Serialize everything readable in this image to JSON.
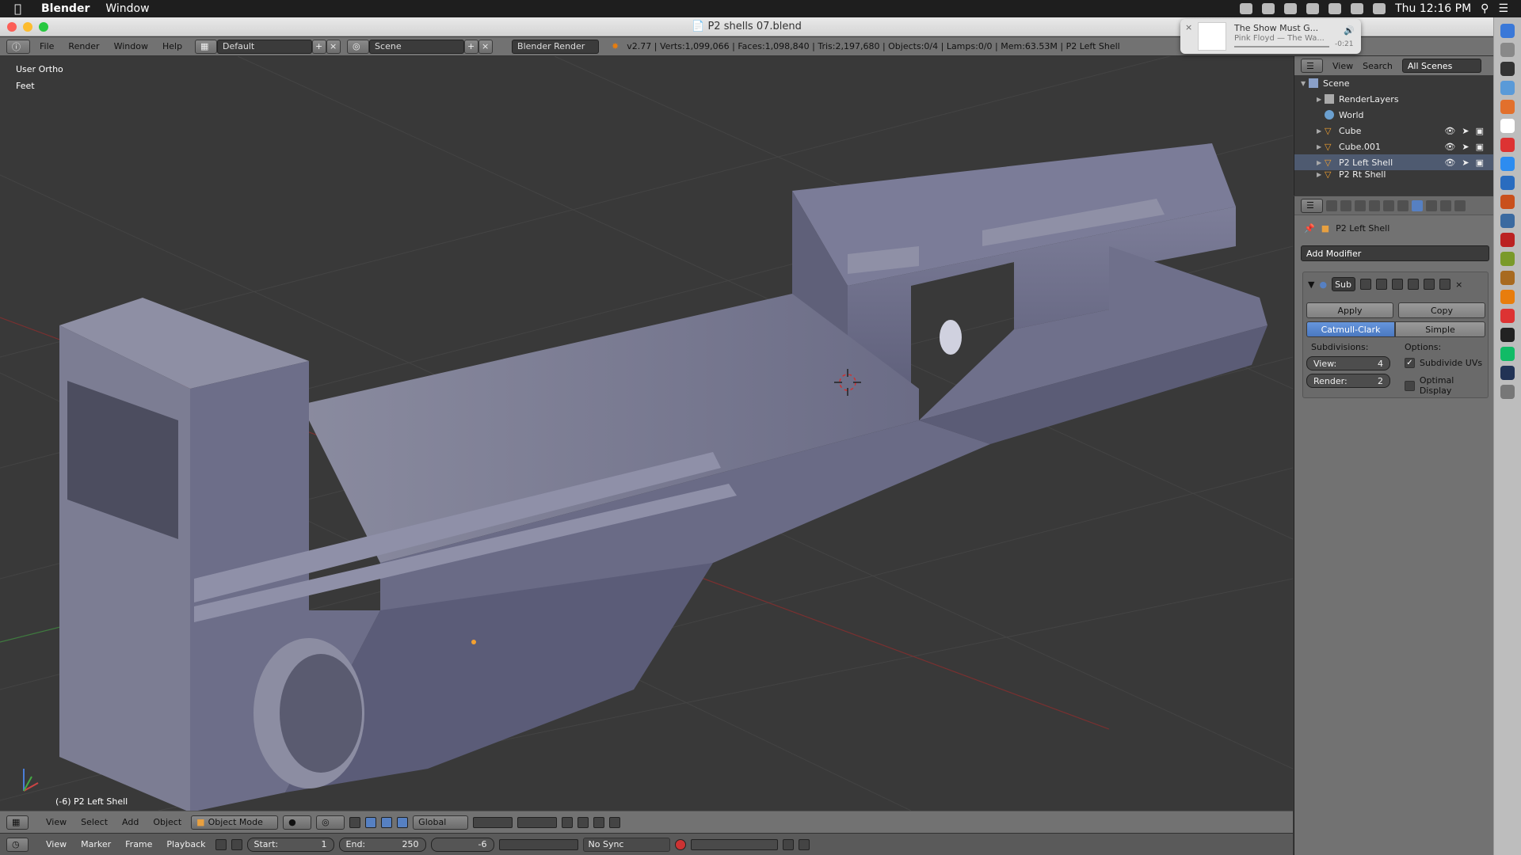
{
  "menubar": {
    "app": "Blender",
    "items": [
      "Window"
    ],
    "clock": "Thu 12:16 PM"
  },
  "window": {
    "title": "P2 shells 07.blend"
  },
  "info": {
    "menus": [
      "File",
      "Render",
      "Window",
      "Help"
    ],
    "layout": "Default",
    "scene": "Scene",
    "engine": "Blender Render",
    "stats": "v2.77 | Verts:1,099,066 | Faces:1,098,840 | Tris:2,197,680 | Objects:0/4 | Lamps:0/0 | Mem:63.53M | P2 Left Shell"
  },
  "viewport": {
    "view_name": "User Ortho",
    "units": "Feet",
    "object_label": "(-6) P2 Left Shell"
  },
  "vp_header": {
    "menus": [
      "View",
      "Select",
      "Add",
      "Object"
    ],
    "mode": "Object Mode",
    "orientation": "Global"
  },
  "timeline": {
    "menus": [
      "View",
      "Marker",
      "Frame",
      "Playback"
    ],
    "start": "Start:",
    "start_val": "1",
    "end": "End:",
    "end_val": "250",
    "current": "-6",
    "sync": "No Sync"
  },
  "outliner": {
    "menus": [
      "View",
      "Search"
    ],
    "filter": "All Scenes",
    "items": [
      {
        "label": "Scene"
      },
      {
        "label": "RenderLayers"
      },
      {
        "label": "World"
      },
      {
        "label": "Cube"
      },
      {
        "label": "Cube.001"
      },
      {
        "label": "P2 Left Shell"
      },
      {
        "label": "P2 Rt Shell"
      }
    ]
  },
  "props": {
    "object": "P2 Left Shell",
    "add_modifier": "Add Modifier",
    "mod_name": "Sub",
    "apply": "Apply",
    "copy": "Copy",
    "mode_a": "Catmull-Clark",
    "mode_b": "Simple",
    "subdivisions": "Subdivisions:",
    "options": "Options:",
    "view_label": "View:",
    "view_val": "4",
    "render_label": "Render:",
    "render_val": "2",
    "opt1": "Subdivide UVs",
    "opt2": "Optimal Display"
  },
  "notification": {
    "title": "The Show Must G...",
    "subtitle": "Pink Floyd — The Wa...",
    "time": "-0:21"
  },
  "colors": {
    "accent": "#5680c2",
    "mesh": "#6e6f8c"
  }
}
